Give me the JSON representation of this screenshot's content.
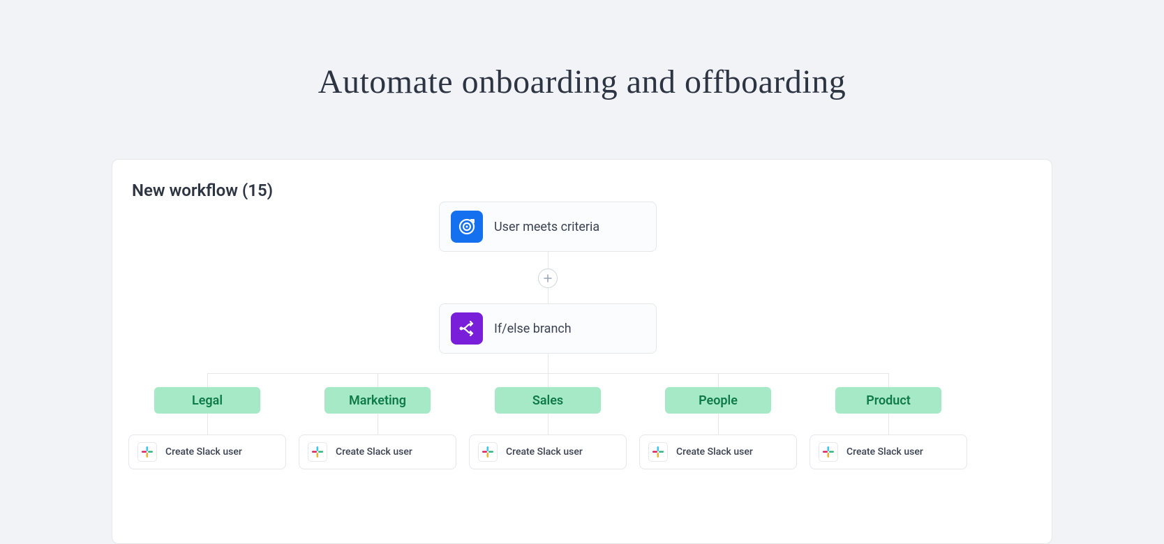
{
  "page": {
    "title": "Automate onboarding and offboarding"
  },
  "workflow": {
    "title": "New workflow (15)",
    "trigger": {
      "label": "User meets criteria"
    },
    "condition": {
      "label": "If/else branch"
    },
    "branches": [
      {
        "name": "Legal",
        "action": "Create Slack user"
      },
      {
        "name": "Marketing",
        "action": "Create Slack user"
      },
      {
        "name": "Sales",
        "action": "Create Slack user"
      },
      {
        "name": "People",
        "action": "Create Slack user"
      },
      {
        "name": "Product",
        "action": "Create Slack user"
      }
    ]
  }
}
